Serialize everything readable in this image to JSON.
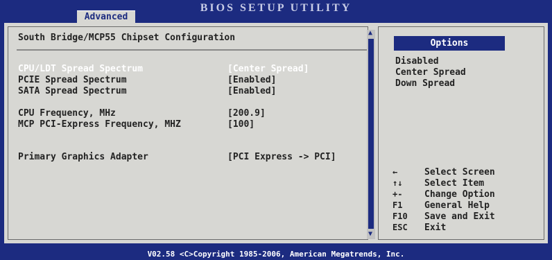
{
  "app": {
    "title": "BIOS SETUP UTILITY",
    "active_tab": "Advanced"
  },
  "panel": {
    "heading": "South Bridge/MCP55 Chipset Configuration",
    "rows": [
      {
        "label": "CPU/LDT Spread Spectrum",
        "value": "[Center Spread]",
        "selected": true
      },
      {
        "label": "PCIE Spread Spectrum",
        "value": "[Enabled]"
      },
      {
        "label": "SATA Spread Spectrum",
        "value": "[Enabled]"
      },
      {
        "label": "CPU Frequency, MHz",
        "value": "[200.9]"
      },
      {
        "label": "MCP PCI-Express Frequency, MHZ",
        "value": "[100]"
      },
      {
        "label": "Primary Graphics Adapter",
        "value": "[PCI Express -> PCI]"
      }
    ]
  },
  "options": {
    "header": "Options",
    "items": [
      "Disabled",
      "Center Spread",
      "Down Spread"
    ]
  },
  "help": [
    {
      "key": "←",
      "action": "Select Screen"
    },
    {
      "key": "↑↓",
      "action": "Select Item"
    },
    {
      "key": "+-",
      "action": "Change Option"
    },
    {
      "key": "F1",
      "action": "General Help"
    },
    {
      "key": "F10",
      "action": "Save and Exit"
    },
    {
      "key": "ESC",
      "action": "Exit"
    }
  ],
  "footer": "V02.58 <C>Copyright 1985-2006, American Megatrends, Inc.",
  "colors": {
    "background": "#1c2b80",
    "panel": "#d7d7d3",
    "highlight": "#ffffff"
  }
}
